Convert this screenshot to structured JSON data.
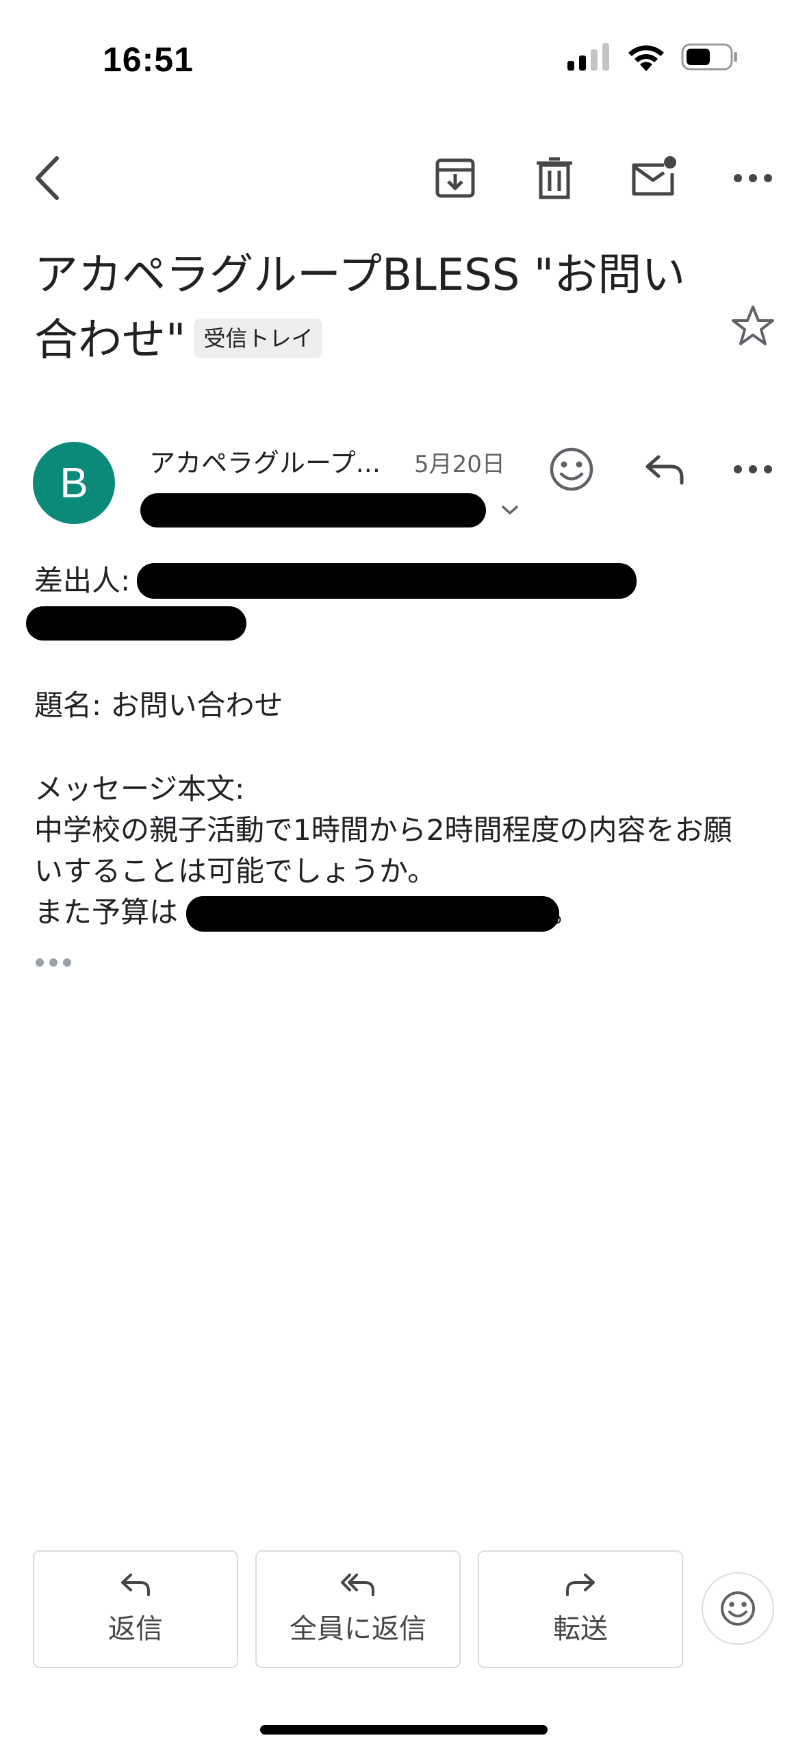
{
  "status_bar": {
    "time": "16:51"
  },
  "toolbar": {
    "back_icon": "chevron-left-icon",
    "archive_icon": "archive-icon",
    "delete_icon": "trash-icon",
    "mark_unread_icon": "mail-unread-icon",
    "more_icon": "more-horizontal-icon"
  },
  "email": {
    "subject": "アカペラグループBLESS \"お問い合わせ\"",
    "label": "受信トレイ",
    "sender_initial": "B",
    "sender_name": "アカペラグループ...",
    "date": "5月20日",
    "body": {
      "from_label": "差出人:",
      "subject_line": "題名: お問い合わせ",
      "message_label": "メッセージ本文:",
      "line1": "中学校の親子活動で1時間から2時間程度の内容をお願",
      "line2": "いすることは可能でしょうか。",
      "line3_prefix": "また予算は",
      "line3_suffix": "。"
    }
  },
  "actions": {
    "reply": "返信",
    "reply_all": "全員に返信",
    "forward": "転送"
  },
  "colors": {
    "avatar": "#0b8a7a",
    "text": "#202124",
    "icon": "#5f6368",
    "border": "#dadce0"
  }
}
